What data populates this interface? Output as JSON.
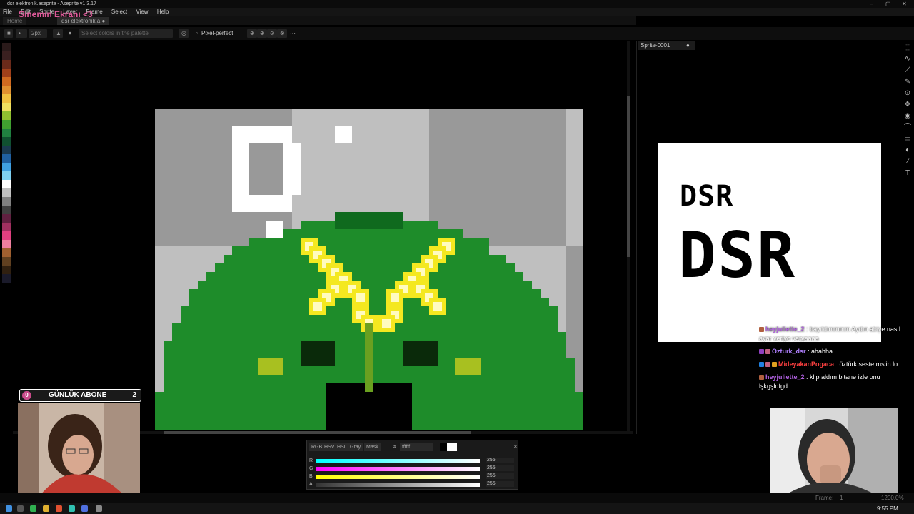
{
  "window": {
    "title": "dsr elektronik.aseprite - Aseprite v1.3.17",
    "controls": [
      "–",
      "▢",
      "✕"
    ]
  },
  "overlay_title": "Sinemin Ekranı <3",
  "menu": [
    "File",
    "Edit",
    "Sprite",
    "Layer",
    "Frame",
    "Select",
    "View",
    "Help"
  ],
  "tabs": [
    {
      "label": "Home",
      "active": false
    },
    {
      "label": "dsr elektronik.a",
      "active": true
    }
  ],
  "context_bar": {
    "brush_size": "2px",
    "palette_selector_placeholder": "Select colors in the palette",
    "pixel_perfect_label": "Pixel-perfect"
  },
  "palette_colors": [
    "#2a1a1a",
    "#3a2020",
    "#6a2a1a",
    "#a0401a",
    "#d06a20",
    "#e09030",
    "#f0c040",
    "#f0e060",
    "#90c030",
    "#40a030",
    "#208040",
    "#105030",
    "#1a3a50",
    "#2060a0",
    "#40a0e0",
    "#80d0f0",
    "#ffffff",
    "#c0c0c0",
    "#808080",
    "#404040",
    "#602040",
    "#a03060",
    "#e04080",
    "#f080a0",
    "#a06030",
    "#604020",
    "#302010",
    "#1a1a2a"
  ],
  "preview": {
    "tab_label": "Sprite-0001",
    "line1": "DSR",
    "line2": "DSR"
  },
  "color_picker": {
    "tabs": [
      "RGB",
      "HSV",
      "HSL",
      "Gray",
      "Mask"
    ],
    "hex_label": "#",
    "hex_value": "ffffff",
    "channels": [
      {
        "label": "R",
        "value": "255",
        "gradient": "linear-gradient(90deg,#00ffff,#ffffff)"
      },
      {
        "label": "G",
        "value": "255",
        "gradient": "linear-gradient(90deg,#ff00ff,#ffffff)"
      },
      {
        "label": "B",
        "value": "255",
        "gradient": "linear-gradient(90deg,#ffff00,#ffffff)"
      },
      {
        "label": "A",
        "value": "255",
        "gradient": "linear-gradient(90deg,#333333,#ffffff)"
      }
    ]
  },
  "stream": {
    "abone_label": "GÜNLÜK ABONE",
    "abone_zero": "0",
    "abone_count": "2"
  },
  "chat": [
    {
      "user": "heyjuliette_2",
      "user_color": "#b060e0",
      "text": ": bayıldımmmm Aydın abiye nasıl ayar veriyo varyaaaa",
      "badges": [
        "#b06040"
      ]
    },
    {
      "user": "Ozturk_dsr",
      "user_color": "#b080ff",
      "text": ": ahahha",
      "badges": [
        "#9040c0",
        "#c06080"
      ]
    },
    {
      "user": "MideyakanPogaca",
      "user_color": "#ff4040",
      "text": ": öztürk seste msiin lo",
      "badges": [
        "#2080e0",
        "#c06080",
        "#e0a020"
      ]
    },
    {
      "user": "heyjuliette_2",
      "user_color": "#b060e0",
      "text": ": klip aldım bitane izle onu lşkgşldfgd",
      "badges": [
        "#b06040"
      ]
    }
  ],
  "status_bar": {
    "frame_label": "Frame:",
    "frame_value": "1",
    "zoom": "1200.0%"
  },
  "taskbar": {
    "time": "9:55 PM"
  }
}
